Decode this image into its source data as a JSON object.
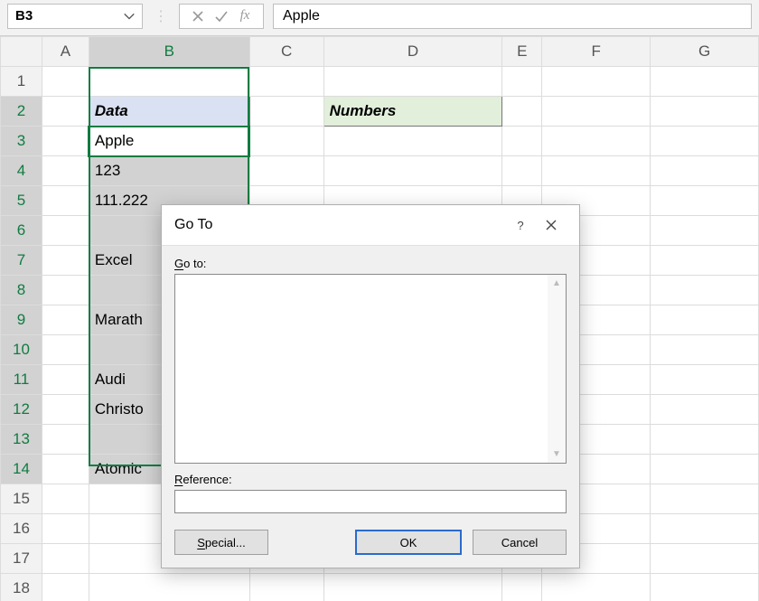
{
  "formula_bar": {
    "name_box": "B3",
    "fx_label": "fx",
    "formula_value": "Apple"
  },
  "columns": [
    "A",
    "B",
    "C",
    "D",
    "E",
    "F",
    "G"
  ],
  "rows_visible": 18,
  "cells": {
    "B2": {
      "text": "Data"
    },
    "D2": {
      "text": "Numbers"
    },
    "B3": {
      "text": "Apple"
    },
    "B4": {
      "text": "123"
    },
    "B5": {
      "text": "111.222"
    },
    "B7": {
      "text": "Excel"
    },
    "B9": {
      "text": "Marath"
    },
    "B11": {
      "text": "Audi"
    },
    "B12": {
      "text": "Christo"
    },
    "B14": {
      "text": "Atomic"
    }
  },
  "dialog": {
    "title": "Go To",
    "goto_label": "Go to:",
    "reference_label": "Reference:",
    "special_button": "Special...",
    "ok_button": "OK",
    "cancel_button": "Cancel",
    "special_underline_letter": "S",
    "reference_underline_letter": "R",
    "goto_underline_letter": "G"
  }
}
